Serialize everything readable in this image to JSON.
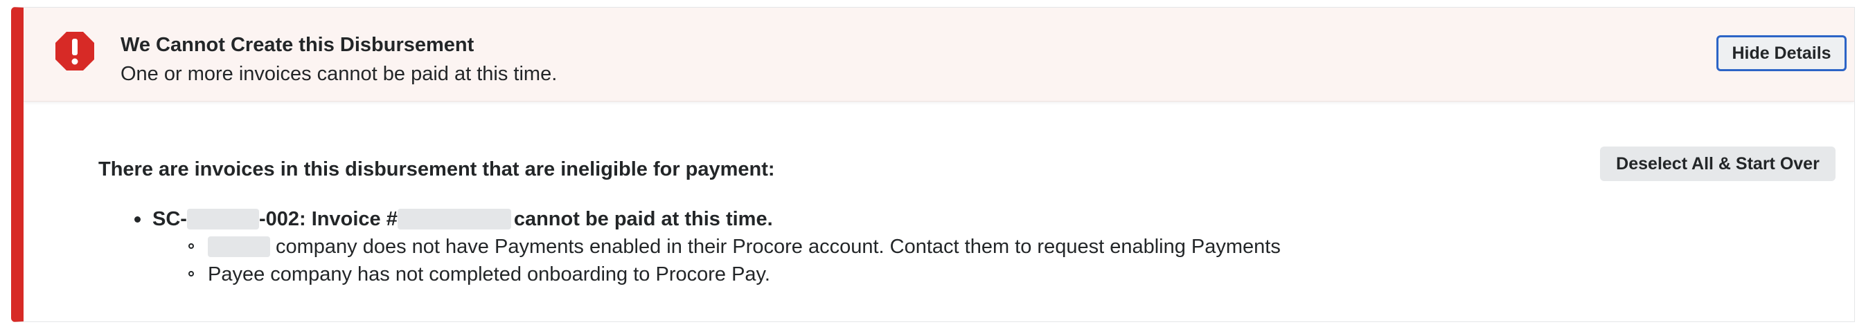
{
  "banner": {
    "title": "We Cannot Create this Disbursement",
    "subtitle": "One or more invoices cannot be paid at this time.",
    "hide_details_label": "Hide Details",
    "icon": "error-octagon-icon",
    "accent_color": "#d72a26"
  },
  "body": {
    "heading": "There are invoices in this disbursement that are ineligible for payment:",
    "deselect_label": "Deselect All & Start Over",
    "invoices": [
      {
        "prefix": "SC-",
        "middle": "-002: Invoice #",
        "suffix": "cannot be paid at this time.",
        "reasons": [
          "company does not have Payments enabled in their Procore account. Contact them to request enabling Payments",
          "Payee company has not completed onboarding to Procore Pay."
        ]
      }
    ]
  }
}
